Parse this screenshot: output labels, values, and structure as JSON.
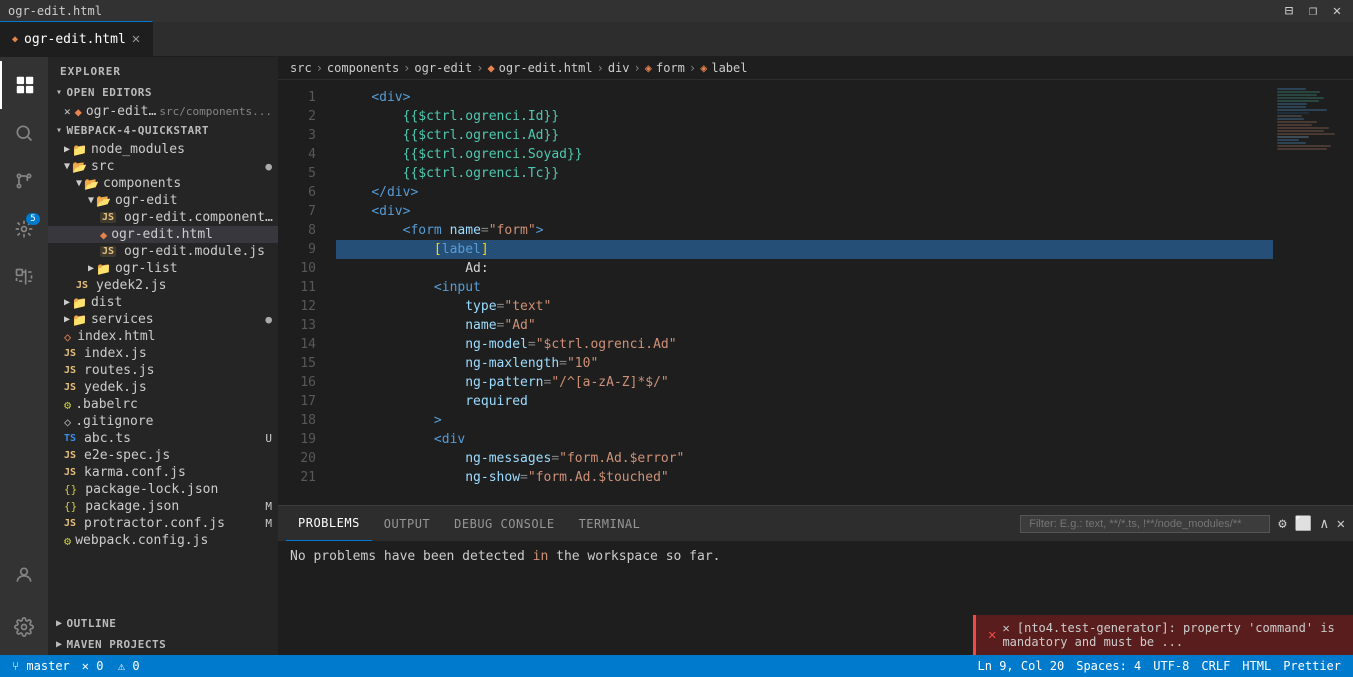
{
  "titleBar": {
    "title": "ogr-edit.html",
    "controls": [
      "⊟",
      "❐",
      "✕"
    ]
  },
  "tabs": [
    {
      "id": "ogr-edit-html",
      "label": "ogr-edit.html",
      "icon": "◆",
      "active": true,
      "modified": false
    }
  ],
  "breadcrumb": {
    "parts": [
      "src",
      "components",
      "ogr-edit",
      "ogr-edit.html",
      "div",
      "form",
      "label"
    ]
  },
  "activityBar": {
    "icons": [
      {
        "id": "explorer",
        "symbol": "⊞",
        "active": true
      },
      {
        "id": "search",
        "symbol": "🔍",
        "active": false
      },
      {
        "id": "git",
        "symbol": "⑂",
        "active": false
      },
      {
        "id": "debug",
        "symbol": "🐛",
        "active": false,
        "badge": "5"
      },
      {
        "id": "extensions",
        "symbol": "⊡",
        "active": false
      },
      {
        "id": "test",
        "symbol": "⚗",
        "active": false
      },
      {
        "id": "settings",
        "symbol": "⚙",
        "active": false
      }
    ]
  },
  "sidebar": {
    "header": "Explorer",
    "sections": [
      {
        "id": "open-editors",
        "label": "Open Editors",
        "expanded": true,
        "items": [
          {
            "id": "ogr-edit-html-open",
            "icon": "✕",
            "name": "ogr-edit.html",
            "path": "src/components...",
            "active": false,
            "indent": 8
          }
        ]
      },
      {
        "id": "webpack-quickstart",
        "label": "Webpack-4-Quickstart",
        "expanded": true,
        "items": [
          {
            "id": "node_modules",
            "icon": "▶",
            "name": "node_modules",
            "indent": 8,
            "type": "folder"
          },
          {
            "id": "src",
            "icon": "▼",
            "name": "src",
            "indent": 8,
            "type": "folder",
            "expanded": true
          },
          {
            "id": "components",
            "icon": "▼",
            "name": "components",
            "indent": 20,
            "type": "folder"
          },
          {
            "id": "ogr-edit",
            "icon": "▼",
            "name": "ogr-edit",
            "indent": 32,
            "type": "folder"
          },
          {
            "id": "ogr-edit-component",
            "icon": "JS",
            "name": "ogr-edit.component.js",
            "indent": 44,
            "type": "js"
          },
          {
            "id": "ogr-edit-html-file",
            "icon": "◆",
            "name": "ogr-edit.html",
            "indent": 44,
            "type": "html",
            "active": true
          },
          {
            "id": "ogr-edit-module",
            "icon": "JS",
            "name": "ogr-edit.module.js",
            "indent": 44,
            "type": "js"
          },
          {
            "id": "ogr-list",
            "icon": "▶",
            "name": "ogr-list",
            "indent": 32,
            "type": "folder"
          },
          {
            "id": "yedek2",
            "icon": "JS",
            "name": "yedek2.js",
            "indent": 20,
            "type": "js"
          },
          {
            "id": "dist",
            "icon": "▶",
            "name": "dist",
            "indent": 8,
            "type": "folder"
          },
          {
            "id": "services",
            "icon": "▶",
            "name": "services",
            "indent": 8,
            "type": "folder",
            "badge": "●"
          },
          {
            "id": "index-html",
            "icon": "◇",
            "name": "index.html",
            "indent": 8,
            "type": "html"
          },
          {
            "id": "index-js",
            "icon": "JS",
            "name": "index.js",
            "indent": 8,
            "type": "js"
          },
          {
            "id": "routes-js",
            "icon": "JS",
            "name": "routes.js",
            "indent": 8,
            "type": "js"
          },
          {
            "id": "yedek-js",
            "icon": "JS",
            "name": "yedek.js",
            "indent": 8,
            "type": "js"
          },
          {
            "id": "babelrc",
            "icon": "⚙",
            "name": ".babelrc",
            "indent": 8,
            "type": "config"
          },
          {
            "id": "gitignore",
            "icon": "◇",
            "name": ".gitignore",
            "indent": 8,
            "type": "config"
          },
          {
            "id": "abc-ts",
            "icon": "TS",
            "name": "abc.ts",
            "indent": 8,
            "type": "ts",
            "badge": "U"
          },
          {
            "id": "e2e-spec",
            "icon": "JS",
            "name": "e2e-spec.js",
            "indent": 8,
            "type": "js"
          },
          {
            "id": "karma-conf",
            "icon": "JS",
            "name": "karma.conf.js",
            "indent": 8,
            "type": "js"
          },
          {
            "id": "package-lock",
            "icon": "{}",
            "name": "package-lock.json",
            "indent": 8,
            "type": "json"
          },
          {
            "id": "package-json",
            "icon": "{}",
            "name": "package.json",
            "indent": 8,
            "type": "json",
            "badge": "M"
          },
          {
            "id": "protractor-conf",
            "icon": "JS",
            "name": "protractor.conf.js",
            "indent": 8,
            "type": "js",
            "badge": "M"
          },
          {
            "id": "webpack-config",
            "icon": "⚙",
            "name": "webpack.config.js",
            "indent": 8,
            "type": "js"
          }
        ]
      }
    ],
    "outline": {
      "label": "Outline"
    },
    "mavenProjects": {
      "label": "Maven Projects"
    }
  },
  "codeLines": [
    {
      "num": 1,
      "content": "    <div>",
      "tokens": [
        {
          "t": "indent",
          "v": "    "
        },
        {
          "t": "tag",
          "v": "<div>"
        }
      ]
    },
    {
      "num": 2,
      "content": "        {{$ctrl.ogrenci.Id}}",
      "tokens": [
        {
          "t": "indent",
          "v": "        "
        },
        {
          "t": "expr",
          "v": "{{$ctrl.ogrenci.Id}}"
        }
      ]
    },
    {
      "num": 3,
      "content": "        {{$ctrl.ogrenci.Ad}}",
      "tokens": [
        {
          "t": "indent",
          "v": "        "
        },
        {
          "t": "expr",
          "v": "{{$ctrl.ogrenci.Ad}}"
        }
      ]
    },
    {
      "num": 4,
      "content": "        {{$ctrl.ogrenci.Soyad}}",
      "tokens": [
        {
          "t": "indent",
          "v": "        "
        },
        {
          "t": "expr",
          "v": "{{$ctrl.ogrenci.Soyad}}"
        }
      ]
    },
    {
      "num": 5,
      "content": "        {{$ctrl.ogrenci.Tc}}",
      "tokens": [
        {
          "t": "indent",
          "v": "        "
        },
        {
          "t": "expr",
          "v": "{{$ctrl.ogrenci.Tc}}"
        }
      ]
    },
    {
      "num": 6,
      "content": "    </div>",
      "tokens": [
        {
          "t": "indent",
          "v": "    "
        },
        {
          "t": "tag",
          "v": "</div>"
        }
      ]
    },
    {
      "num": 7,
      "content": "    <div>",
      "tokens": [
        {
          "t": "indent",
          "v": "    "
        },
        {
          "t": "tag",
          "v": "<div>"
        }
      ]
    },
    {
      "num": 8,
      "content": "        <form name=\"form\">",
      "tokens": [
        {
          "t": "indent",
          "v": "        "
        },
        {
          "t": "tag-open",
          "v": "<"
        },
        {
          "t": "tag",
          "v": "form"
        },
        {
          "t": "attr",
          "v": " name"
        },
        {
          "t": "punct",
          "v": "="
        },
        {
          "t": "string",
          "v": "\"form\""
        },
        {
          "t": "tag-close",
          "v": ">"
        }
      ]
    },
    {
      "num": 9,
      "content": "            [label]",
      "highlight": true,
      "tokens": [
        {
          "t": "indent",
          "v": "            "
        },
        {
          "t": "bracket",
          "v": "["
        },
        {
          "t": "label",
          "v": "label"
        },
        {
          "t": "bracket",
          "v": "]"
        }
      ]
    },
    {
      "num": 10,
      "content": "                Ad:",
      "tokens": [
        {
          "t": "indent",
          "v": "                "
        },
        {
          "t": "text",
          "v": "Ad:"
        }
      ]
    },
    {
      "num": 11,
      "content": "            <input",
      "tokens": [
        {
          "t": "indent",
          "v": "            "
        },
        {
          "t": "tag",
          "v": "<input"
        }
      ]
    },
    {
      "num": 12,
      "content": "                type=\"text\"",
      "tokens": [
        {
          "t": "indent",
          "v": "                "
        },
        {
          "t": "attr",
          "v": "type"
        },
        {
          "t": "punct",
          "v": "="
        },
        {
          "t": "string",
          "v": "\"text\""
        }
      ]
    },
    {
      "num": 13,
      "content": "                name=\"Ad\"",
      "tokens": [
        {
          "t": "indent",
          "v": "                "
        },
        {
          "t": "attr",
          "v": "name"
        },
        {
          "t": "punct",
          "v": "="
        },
        {
          "t": "string",
          "v": "\"Ad\""
        }
      ]
    },
    {
      "num": 14,
      "content": "                ng-model=\"$ctrl.ogrenci.Ad\"",
      "tokens": [
        {
          "t": "indent",
          "v": "                "
        },
        {
          "t": "attr",
          "v": "ng-model"
        },
        {
          "t": "punct",
          "v": "="
        },
        {
          "t": "string",
          "v": "\"$ctrl.ogrenci.Ad\""
        }
      ]
    },
    {
      "num": 15,
      "content": "                ng-maxlength=\"10\"",
      "tokens": [
        {
          "t": "indent",
          "v": "                "
        },
        {
          "t": "attr",
          "v": "ng-maxlength"
        },
        {
          "t": "punct",
          "v": "="
        },
        {
          "t": "string",
          "v": "\"10\""
        }
      ]
    },
    {
      "num": 16,
      "content": "                ng-pattern=\"/^[a-zA-Z]*$/\"",
      "tokens": [
        {
          "t": "indent",
          "v": "                "
        },
        {
          "t": "attr",
          "v": "ng-pattern"
        },
        {
          "t": "punct",
          "v": "="
        },
        {
          "t": "string",
          "v": "\"/^[a-zA-Z]*$/\""
        }
      ]
    },
    {
      "num": 17,
      "content": "                required",
      "tokens": [
        {
          "t": "indent",
          "v": "                "
        },
        {
          "t": "attr",
          "v": "required"
        }
      ]
    },
    {
      "num": 18,
      "content": "            >",
      "tokens": [
        {
          "t": "indent",
          "v": "            "
        },
        {
          "t": "tag",
          "v": ">"
        }
      ]
    },
    {
      "num": 19,
      "content": "            <div",
      "tokens": [
        {
          "t": "indent",
          "v": "            "
        },
        {
          "t": "tag",
          "v": "<div"
        }
      ]
    },
    {
      "num": 20,
      "content": "                ng-messages=\"form.Ad.$error\"",
      "tokens": [
        {
          "t": "indent",
          "v": "                "
        },
        {
          "t": "attr",
          "v": "ng-messages"
        },
        {
          "t": "punct",
          "v": "="
        },
        {
          "t": "string",
          "v": "\"form.Ad.$error\""
        }
      ]
    },
    {
      "num": 21,
      "content": "                ng-show=\"form.Ad.$touched\"",
      "tokens": [
        {
          "t": "indent",
          "v": "                "
        },
        {
          "t": "attr",
          "v": "ng-show"
        },
        {
          "t": "punct",
          "v": "="
        },
        {
          "t": "string",
          "v": "\"form.Ad.$touched\""
        }
      ]
    }
  ],
  "bottomPanel": {
    "tabs": [
      "PROBLEMS",
      "OUTPUT",
      "DEBUG CONSOLE",
      "TERMINAL"
    ],
    "activeTab": "PROBLEMS",
    "filterPlaceholder": "Filter: E.g.: text, **/*.ts, !**/node_modules/**",
    "content": "No problems have been detected in the workspace so far."
  },
  "statusBar": {
    "left": [
      "⑂ master",
      "✕ 0  ⚠ 0"
    ],
    "right": [
      "Ln 9, Col 20",
      "Spaces: 4",
      "UTF-8",
      "CRLF",
      "HTML",
      "Prettier"
    ]
  },
  "errorNotification": {
    "message": "✕ [nto4.test-generator]: property 'command' is mandatory and must be ..."
  }
}
